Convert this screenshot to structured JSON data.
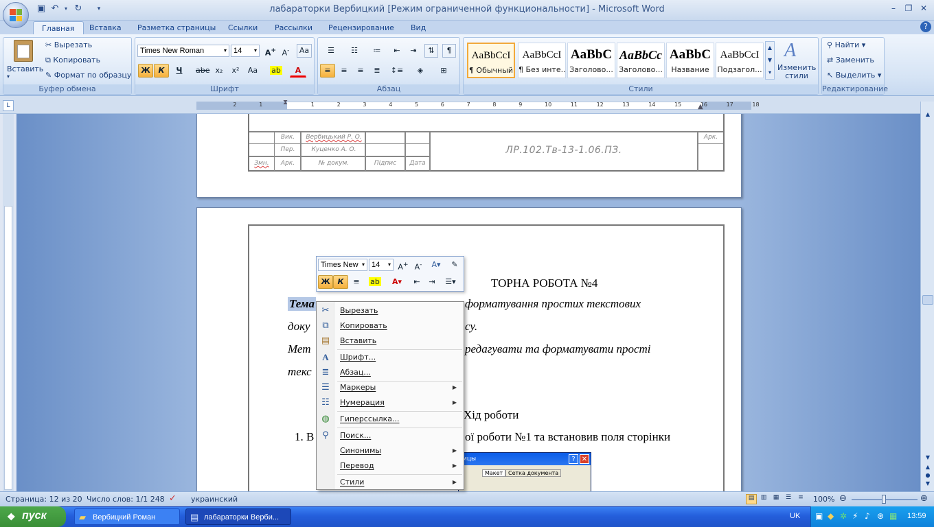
{
  "window": {
    "title": "лабараторки Вербицкий [Режим ограниченной функциональности] - Microsoft Word"
  },
  "qat": {
    "save": "save-icon",
    "undo": "undo-icon",
    "redo": "redo-icon"
  },
  "tabs": [
    "Главная",
    "Вставка",
    "Разметка страницы",
    "Ссылки",
    "Рассылки",
    "Рецензирование",
    "Вид"
  ],
  "clipboard": {
    "paste": "Вставить",
    "cut": "Вырезать",
    "copy": "Копировать",
    "format_painter": "Формат по образцу",
    "group": "Буфер обмена"
  },
  "font": {
    "name": "Times New Roman",
    "size": "14",
    "bold": "Ж",
    "italic": "К",
    "underline": "Ч",
    "strike": "abe",
    "sub": "x₂",
    "sup": "x²",
    "case": "Aa",
    "group": "Шрифт"
  },
  "paragraph": {
    "group": "Абзац"
  },
  "styles": {
    "items": [
      {
        "sample": "AaBbCcI",
        "name": "¶ Обычный"
      },
      {
        "sample": "AaBbCcI",
        "name": "¶ Без инте..."
      },
      {
        "sample": "AaBbC",
        "name": "Заголово..."
      },
      {
        "sample": "AaBbCc",
        "name": "Заголово..."
      },
      {
        "sample": "AaBbC",
        "name": "Название"
      },
      {
        "sample": "AaBbCcI",
        "name": "Подзагол..."
      }
    ],
    "change": "Изменить стили",
    "group": "Стили"
  },
  "editing": {
    "find": "Найти",
    "replace": "Заменить",
    "select": "Выделить",
    "group": "Редактирование"
  },
  "ruler": {
    "numbers": [
      "2",
      "1",
      "1",
      "2",
      "3",
      "4",
      "5",
      "6",
      "7",
      "8",
      "9",
      "10",
      "11",
      "12",
      "13",
      "14",
      "15",
      "16",
      "17",
      "18"
    ]
  },
  "stamp": {
    "vyk": "Вик.",
    "vyk_name": "Вербицький Р. О.",
    "per": "Пер.",
    "per_name": "Куценко А. О.",
    "zmn": "Змн.",
    "ark": "Арк.",
    "doc": "№ докум.",
    "sign": "Підпис",
    "date": "Дата",
    "code": "ЛР.102.Тв-13-1.06.ПЗ.",
    "ark_right": "Арк."
  },
  "doc": {
    "heading": "ЛАБОРАТОРНА РОБОТА №4",
    "heading_visible": "ТОРНА РОБОТА №4",
    "tema": "Тема",
    "line1": "форматування простих текстових",
    "line2_a": "доку",
    "line2_b": "су.",
    "line3_a": "Мет",
    "line3_b": "редагувати та форматувати прості",
    "line4": "текс",
    "hid": "Хід роботи",
    "item1_a": "1.  В",
    "item1_b": "ої роботи №1 та встановив поля сторінки"
  },
  "dialog": {
    "tab1": "Макет",
    "tab2": "Сетка документа",
    "title": "ицы"
  },
  "minitoolbar": {
    "font": "Times New",
    "size": "14"
  },
  "contextmenu": {
    "items": [
      {
        "label": "Вырезать",
        "icon": "scissors-icon"
      },
      {
        "label": "Копировать",
        "icon": "copy-icon"
      },
      {
        "label": "Вставить",
        "icon": "paste-icon"
      },
      {
        "label": "Шрифт...",
        "icon": "font-icon"
      },
      {
        "label": "Абзац...",
        "icon": "paragraph-icon"
      },
      {
        "label": "Маркеры",
        "icon": "bullets-icon"
      },
      {
        "label": "Нумерация",
        "icon": "numbering-icon"
      },
      {
        "label": "Гиперссылка...",
        "icon": "hyperlink-icon"
      },
      {
        "label": "Поиск...",
        "icon": "search-icon"
      },
      {
        "label": "Синонимы",
        "icon": ""
      },
      {
        "label": "Перевод",
        "icon": ""
      },
      {
        "label": "Стили",
        "icon": ""
      }
    ]
  },
  "status": {
    "page": "Страница: 12 из 20",
    "words": "Число слов: 1/1 248",
    "lang": "украинский",
    "zoom": "100%"
  },
  "taskbar": {
    "start": "пуск",
    "task1": "Вербицкий Роман",
    "task2": "лабараторки Верби...",
    "lang": "UK",
    "clock": "13:59"
  }
}
